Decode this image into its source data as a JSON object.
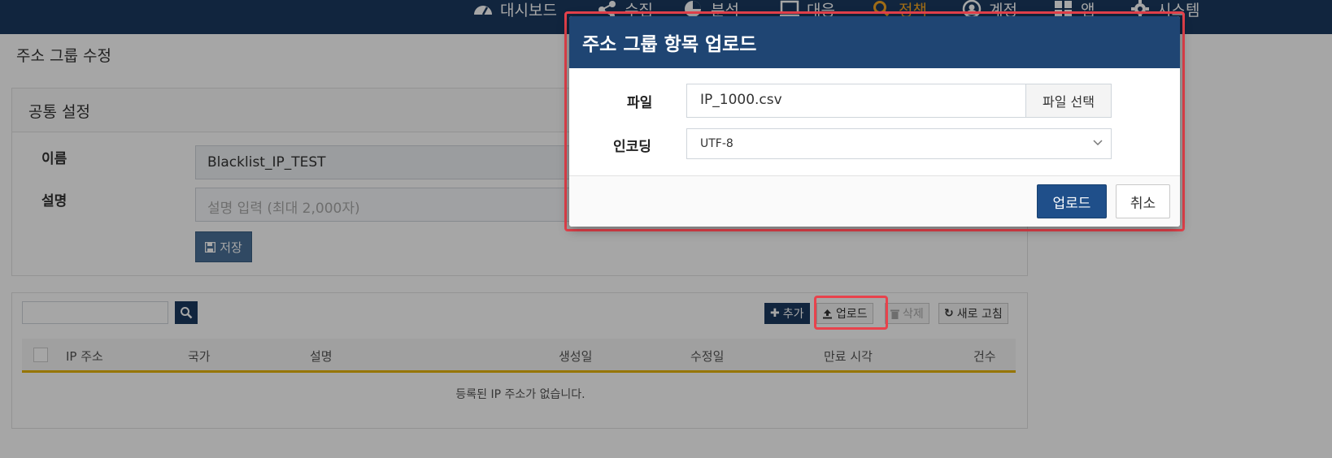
{
  "nav": {
    "items": [
      {
        "label": "대시보드",
        "icon": "dashboard-icon"
      },
      {
        "label": "수집",
        "icon": "share-icon"
      },
      {
        "label": "분석",
        "icon": "pie-chart-icon"
      },
      {
        "label": "대응",
        "icon": "monitor-icon"
      },
      {
        "label": "정책",
        "icon": "search-icon",
        "active": true
      },
      {
        "label": "계정",
        "icon": "user-icon"
      },
      {
        "label": "앱",
        "icon": "grid-icon"
      },
      {
        "label": "시스템",
        "icon": "gear-icon"
      }
    ],
    "active_color": "#f5a623",
    "bg_color": "#1b3a60"
  },
  "page": {
    "title": "주소 그룹 수정"
  },
  "common_settings": {
    "title": "공통 설정",
    "name_label": "이름",
    "name_value": "Blacklist_IP_TEST",
    "desc_label": "설명",
    "desc_placeholder": "설명 입력 (최대 2,000자)",
    "save_label": "저장"
  },
  "list": {
    "toolbar": {
      "add_label": "추가",
      "upload_label": "업로드",
      "delete_label": "삭제",
      "refresh_label": "새로 고침"
    },
    "columns": [
      "IP 주소",
      "국가",
      "설명",
      "생성일",
      "수정일",
      "만료 시각",
      "건수"
    ],
    "empty_message": "등록된 IP 주소가 없습니다."
  },
  "modal": {
    "title": "주소 그룹 항목 업로드",
    "file_label": "파일",
    "file_value": "IP_1000.csv",
    "file_button": "파일 선택",
    "encoding_label": "인코딩",
    "encoding_value": "UTF-8",
    "upload_button": "업로드",
    "cancel_button": "취소"
  },
  "colors": {
    "header": "#1f4573",
    "primary_button": "#1f4f8a",
    "highlight": "#e8424c",
    "table_accent": "#e6b400"
  }
}
